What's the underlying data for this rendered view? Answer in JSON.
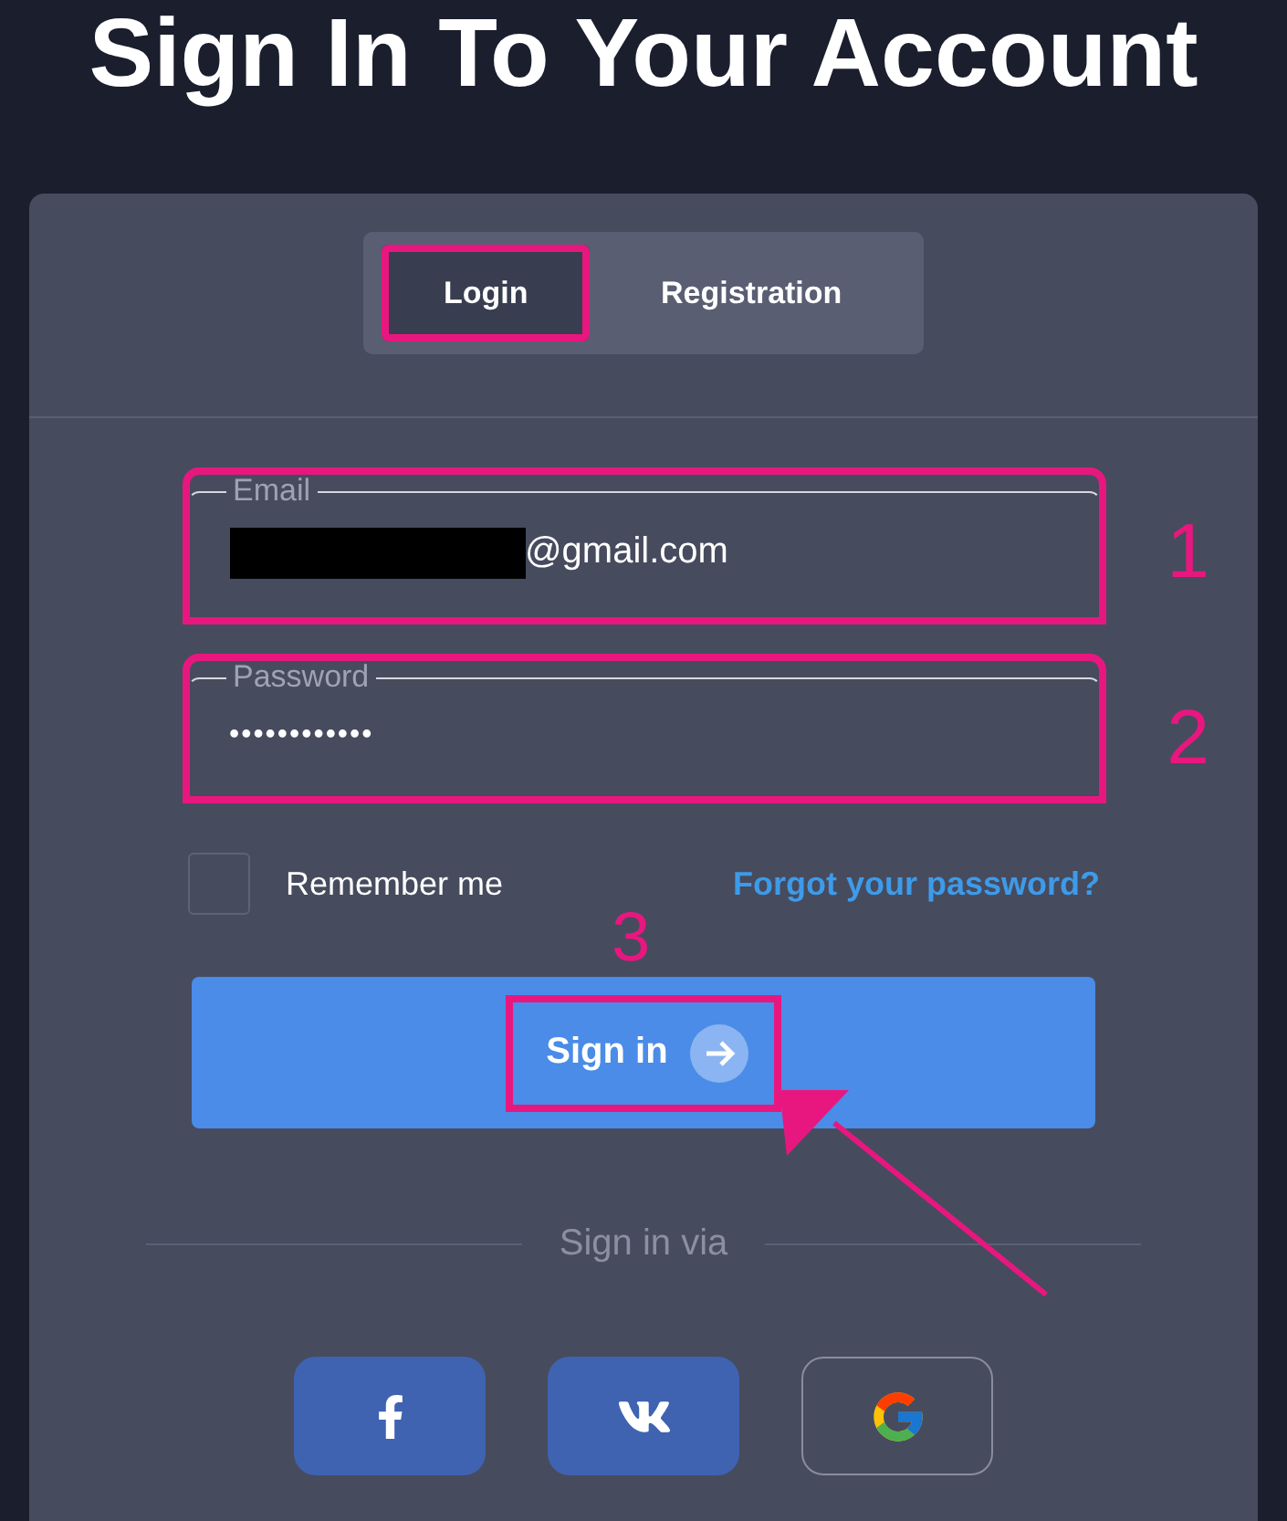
{
  "heading": "Sign In To Your Account",
  "tabs": [
    {
      "label": "Login",
      "selected": true,
      "highlighted": true
    },
    {
      "label": "Registration",
      "selected": false,
      "highlighted": false
    }
  ],
  "fields": [
    {
      "kind": "email",
      "label": "Email",
      "value": "@gmail.com",
      "redacted": true,
      "highlighted": true,
      "annotation": "1"
    },
    {
      "kind": "password",
      "label": "Password",
      "value": "••••••••••••",
      "redacted": false,
      "highlighted": true,
      "annotation": "2"
    }
  ],
  "remember": {
    "label": "Remember me",
    "checked": false
  },
  "forgot_link": "Forgot your password?",
  "submit": {
    "label": "Sign in",
    "highlighted": true,
    "annotation": "3",
    "pointer_arrow": true
  },
  "divider_label": "Sign in via",
  "social": [
    {
      "kind": "facebook"
    },
    {
      "kind": "vk"
    },
    {
      "kind": "google"
    }
  ]
}
